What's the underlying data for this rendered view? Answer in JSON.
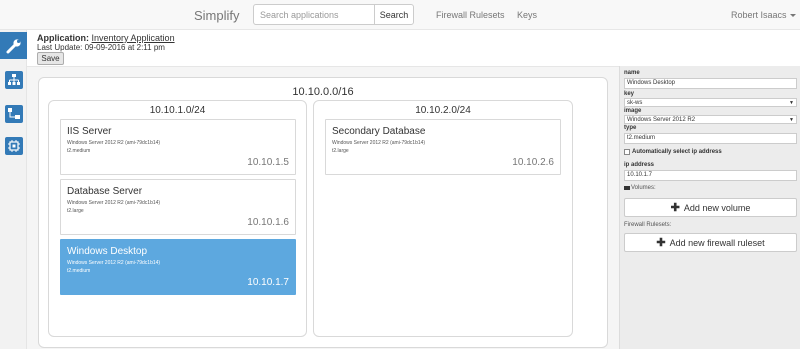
{
  "navbar": {
    "brand": "Simplify",
    "search_placeholder": "Search applications",
    "search_button": "Search",
    "links": [
      "Firewall Rulesets",
      "Keys"
    ],
    "user": "Robert Isaacs"
  },
  "sidebar": {
    "icons": [
      "wrench-icon",
      "network-icon",
      "topology-icon",
      "chip-icon"
    ]
  },
  "header": {
    "app_label": "Application:",
    "app_name": "Inventory Application",
    "last_update": "Last Update: 09-09-2016 at 2:11 pm",
    "save_label": "Save"
  },
  "vpc": {
    "cidr": "10.10.0.0/16",
    "subnets": [
      {
        "cidr": "10.10.1.0/24",
        "instances": [
          {
            "name": "IIS Server",
            "image": "Windows Server 2012 R2 (ami-79dc1b14)",
            "type": "t2.medium",
            "ip": "10.10.1.5",
            "selected": false
          },
          {
            "name": "Database Server",
            "image": "Windows Server 2012 R2 (ami-79dc1b14)",
            "type": "t2.large",
            "ip": "10.10.1.6",
            "selected": false
          },
          {
            "name": "Windows Desktop",
            "image": "Windows Server 2012 R2 (ami-79dc1b14)",
            "type": "t2.medium",
            "ip": "10.10.1.7",
            "selected": true
          }
        ]
      },
      {
        "cidr": "10.10.2.0/24",
        "instances": [
          {
            "name": "Secondary Database",
            "image": "Windows Server 2012 R2 (ami-79dc1b14)",
            "type": "t2.large",
            "ip": "10.10.2.6",
            "selected": false
          }
        ]
      }
    ]
  },
  "panel": {
    "name_label": "name",
    "name_value": "Windows Desktop",
    "key_label": "key",
    "key_value": "sk-ws",
    "image_label": "image",
    "image_value": "Windows Server 2012 R2",
    "type_label": "type",
    "type_value": "t2.medium",
    "auto_ip_label": "Automatically select ip address",
    "ip_label": "ip address",
    "ip_value": "10.10.1.7",
    "volumes_label": "Volumes:",
    "add_volume": "Add new volume",
    "firewall_label": "Firewall Rulesets:",
    "add_firewall": "Add new firewall ruleset"
  },
  "colors": {
    "primary": "#337ab7",
    "selected_instance": "#5da8df"
  }
}
